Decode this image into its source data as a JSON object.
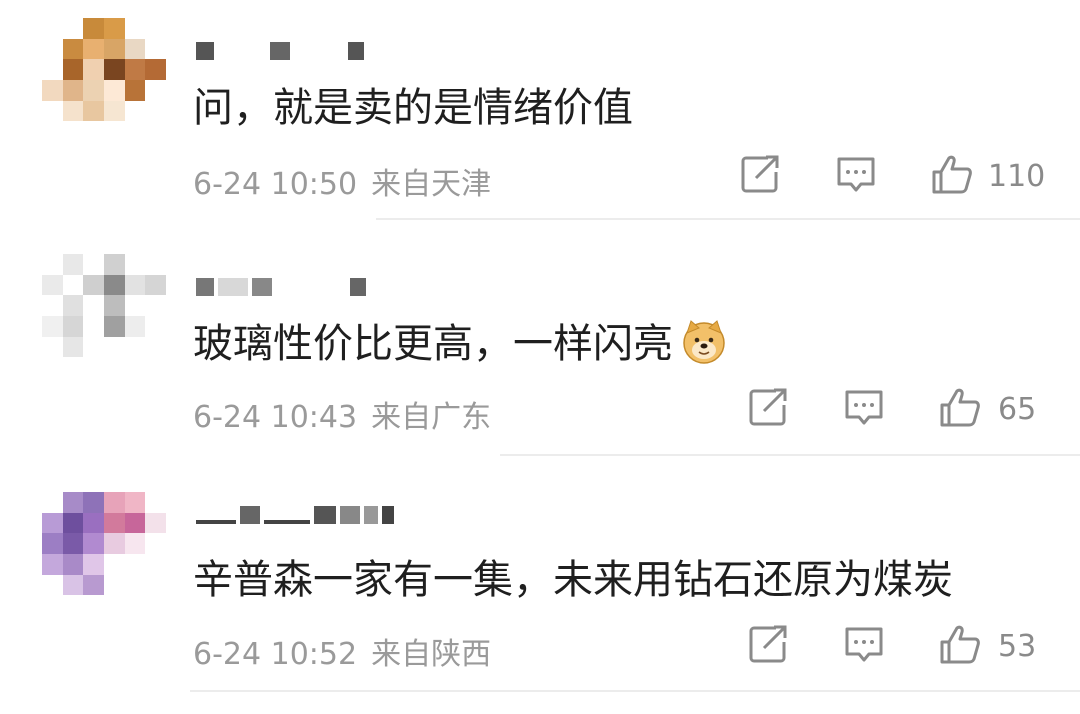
{
  "comments": [
    {
      "text": "问，就是卖的是情绪价值",
      "time": "6-24 10:50",
      "location": "来自天津",
      "likes": "110"
    },
    {
      "text": "玻璃性价比更高，一样闪亮",
      "emoji": "doge-emoji",
      "time": "6-24 10:43",
      "location": "来自广东",
      "likes": "65"
    },
    {
      "text": "辛普森一家有一集，未来用钻石还原为煤炭",
      "time": "6-24 10:52",
      "location": "来自陕西",
      "likes": "53"
    }
  ],
  "icons": {
    "share": "share-icon",
    "comment": "comment-icon",
    "like": "thumbs-up-icon"
  },
  "colors": {
    "text": "#1f1f1f",
    "meta": "#9a9a9a",
    "icon": "#8a8a8a",
    "divider": "#ececec"
  }
}
